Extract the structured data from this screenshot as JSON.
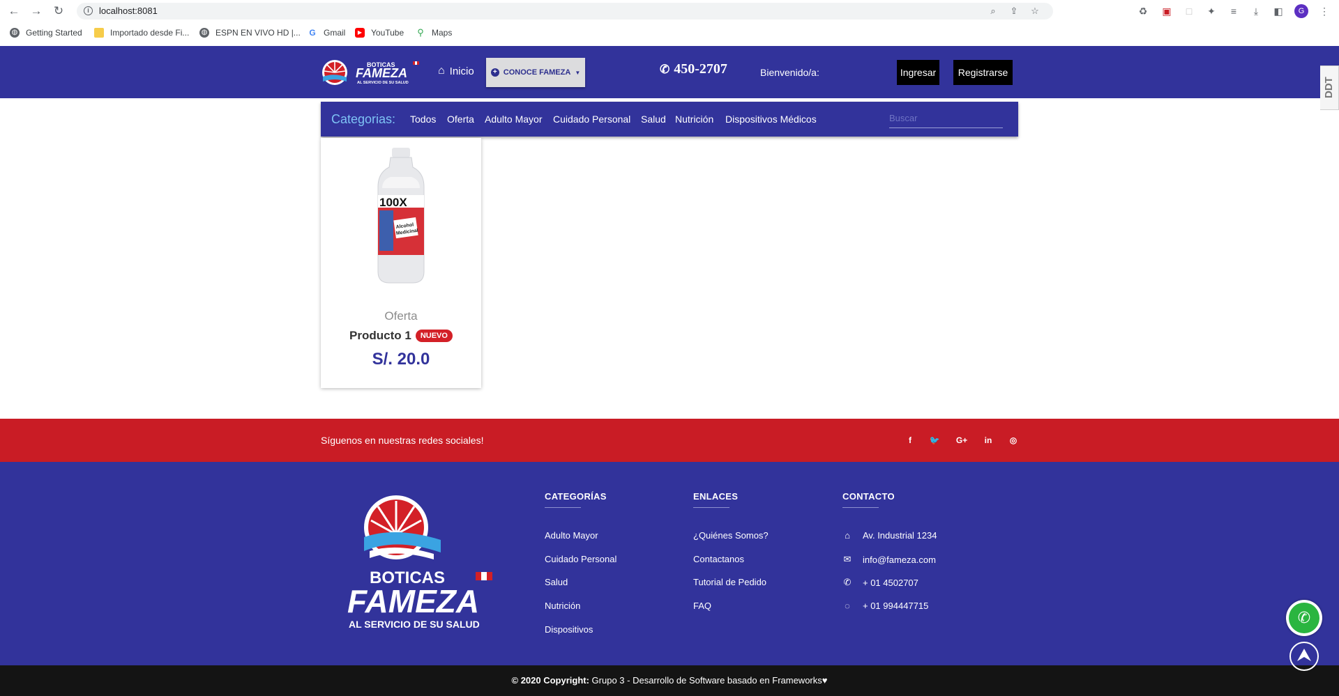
{
  "browser": {
    "url": "localhost:8081",
    "profile_initial": "G",
    "bookmarks": [
      {
        "label": "Getting Started"
      },
      {
        "label": "Importado desde Fi..."
      },
      {
        "label": "ESPN EN VIVO HD |..."
      },
      {
        "label": "Gmail"
      },
      {
        "label": "YouTube"
      },
      {
        "label": "Maps"
      }
    ]
  },
  "header": {
    "logo_top": "BOTICAS",
    "logo_main": "FAMEZA",
    "logo_sub": "AL SERVICIO DE SU SALUD",
    "nav_home": "Inicio",
    "dropdown_label": "CONOCE FAMEZA",
    "phone": "450-2707",
    "welcome": "Bienvenido/a:",
    "login_label": "Ingresar",
    "register_label": "Registrarse",
    "side_tab": "DDT"
  },
  "categories": {
    "title": "Categorias:",
    "items": [
      {
        "label": "Todos"
      },
      {
        "label": "Oferta"
      },
      {
        "label": "Adulto Mayor"
      },
      {
        "label": "Cuidado Personal"
      },
      {
        "label": "Salud"
      },
      {
        "label": "Nutrición"
      },
      {
        "label": "Dispositivos Médicos"
      }
    ],
    "search_placeholder": "Buscar"
  },
  "products": [
    {
      "category": "Oferta",
      "name": "Producto 1",
      "badge": "NUEVO",
      "price": "S/. 20.0",
      "label_brand": "100X",
      "label_text_1": "Alcohol",
      "label_text_2": "Medicinal"
    }
  ],
  "social": {
    "text": "Síguenos en nuestras redes sociales!",
    "icons": [
      {
        "name": "facebook-icon",
        "glyph": "f"
      },
      {
        "name": "twitter-icon",
        "glyph": "🐦"
      },
      {
        "name": "google-plus-icon",
        "glyph": "G+"
      },
      {
        "name": "linkedin-icon",
        "glyph": "in"
      },
      {
        "name": "instagram-icon",
        "glyph": "◎"
      }
    ]
  },
  "footer": {
    "categorias": {
      "title": "CATEGORÍAS",
      "links": [
        "Adulto Mayor",
        "Cuidado Personal",
        "Salud",
        "Nutrición",
        "Dispositivos"
      ]
    },
    "enlaces": {
      "title": "ENLACES",
      "links": [
        "¿Quiénes Somos?",
        "Contactanos",
        "Tutorial de Pedido",
        "FAQ"
      ]
    },
    "contacto": {
      "title": "CONTACTO",
      "items": [
        {
          "icon": "home-icon",
          "text": "Av. Industrial 1234"
        },
        {
          "icon": "envelope-icon",
          "text": "info@fameza.com"
        },
        {
          "icon": "phone-icon",
          "text": "+ 01 4502707"
        },
        {
          "icon": "whatsapp-icon",
          "text": "+ 01 994447715"
        }
      ]
    }
  },
  "copyright": {
    "prefix": "© 2020 Copyright:",
    "text": " Grupo 3 - Desarrollo de Software basado en Frameworks",
    "heart": "♥"
  },
  "colors": {
    "brand_blue": "#32339b",
    "brand_red": "#c91c25",
    "category_title": "#7ec3f5",
    "footer_bottom": "#141414"
  }
}
